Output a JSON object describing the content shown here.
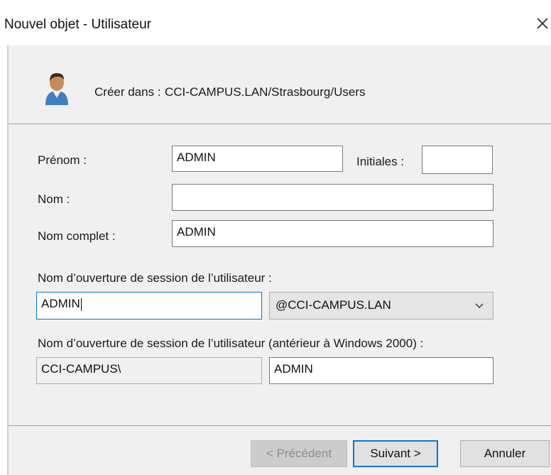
{
  "window": {
    "title": "Nouvel objet - Utilisateur",
    "close_icon": "close-icon"
  },
  "location": {
    "icon": "user-icon",
    "label": "Créer dans :",
    "path": "CCI-CAMPUS.LAN/Strasbourg/Users"
  },
  "form": {
    "first_name": {
      "label": "Prénom :",
      "value": "ADMIN"
    },
    "initials": {
      "label": "Initiales :",
      "value": ""
    },
    "last_name": {
      "label": "Nom :",
      "value": ""
    },
    "full_name": {
      "label": "Nom complet :",
      "value": "ADMIN"
    },
    "logon": {
      "label": "Nom d’ouverture de session de l’utilisateur :",
      "value": "ADMIN",
      "domain_selected": "@CCI-CAMPUS.LAN"
    },
    "logon_pre2000": {
      "label": "Nom d’ouverture de session de l’utilisateur (antérieur à Windows 2000) :",
      "domain": "CCI-CAMPUS\\",
      "value": "ADMIN"
    }
  },
  "buttons": {
    "previous": "< Précédent",
    "next": "Suivant >",
    "cancel": "Annuler"
  },
  "colors": {
    "focus_border": "#0078d7",
    "panel_bg": "#f0f0f0"
  }
}
